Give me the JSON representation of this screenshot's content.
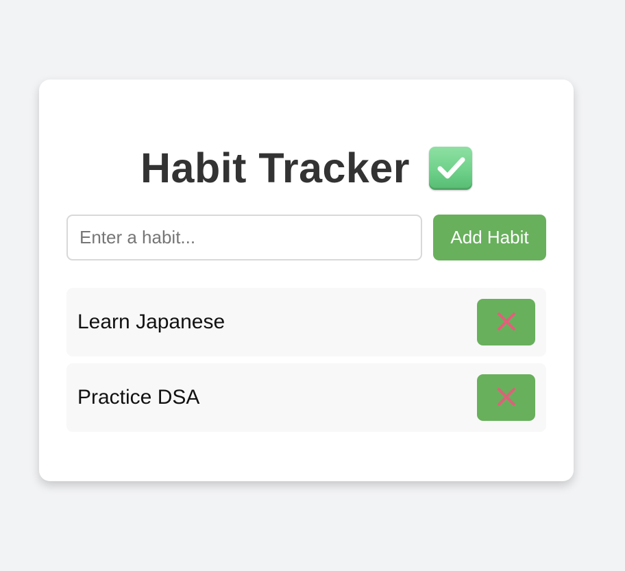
{
  "app": {
    "title": "Habit Tracker"
  },
  "form": {
    "placeholder": "Enter a habit...",
    "value": "",
    "add_label": "Add Habit"
  },
  "habits": [
    {
      "label": "Learn Japanese",
      "delete_icon": "cross-mark-icon"
    },
    {
      "label": "Practice DSA",
      "delete_icon": "cross-mark-icon"
    }
  ],
  "colors": {
    "page_background": "#f2f3f5",
    "card_background": "#ffffff",
    "accent_green": "#68b05c",
    "title_text": "#333333",
    "item_background": "#f8f8f8",
    "cross_mark": "#e0607a",
    "check_icon_green": "#6fd18a"
  }
}
